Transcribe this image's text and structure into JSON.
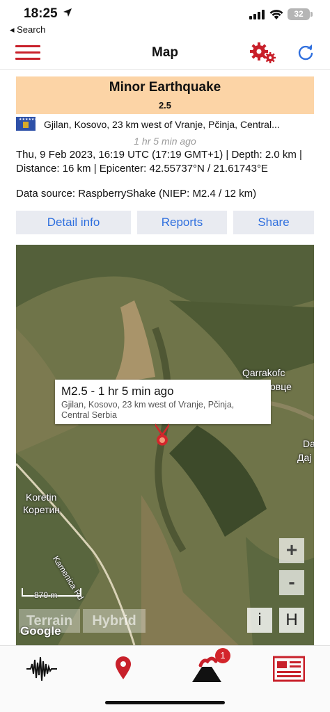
{
  "status_bar": {
    "time": "18:25",
    "back_label": "◂ Search",
    "battery": "32"
  },
  "navbar": {
    "title": "Map"
  },
  "quake": {
    "type": "Minor Earthquake",
    "magnitude": "2.5",
    "location": "Gjilan, Kosovo, 23 km west of Vranje, Pčinja, Central...",
    "time_ago": "1 hr 5 min ago",
    "details": "Thu, 9 Feb 2023, 16:19 UTC (17:19 GMT+1) | Depth: 2.0 km | Distance: 16 km | Epicenter: 42.55737°N / 21.61743°E",
    "source": "Data source: RaspberryShake (NIEP: M2.4 / 12 km)"
  },
  "actions": {
    "detail": "Detail info",
    "reports": "Reports",
    "share": "Share"
  },
  "map": {
    "popup_title": "M2.5 - 1 hr 5 min ago",
    "popup_subtitle": "Gjilan, Kosovo, 23 km west of Vranje, Pčinja, Central Serbia",
    "labels": {
      "qarrakofc": "Qarrakofc",
      "qarrakofc_cyr": "овце",
      "koretin": "Koretin",
      "koretin_cyr": "Коретин",
      "road": "Kamenica Rd",
      "da": "Da",
      "da_cyr": "Дај"
    },
    "scale_label": "870 m",
    "zoom_in": "+",
    "zoom_out": "-",
    "terrain": "Terrain",
    "hybrid": "Hybrid",
    "google": "Google",
    "info_btn": "i",
    "h_btn": "H"
  },
  "tabbar": {
    "badge": "1"
  },
  "colors": {
    "accent_red": "#c8202a",
    "link_blue": "#2f6fde",
    "banner": "#fcd4a6"
  }
}
